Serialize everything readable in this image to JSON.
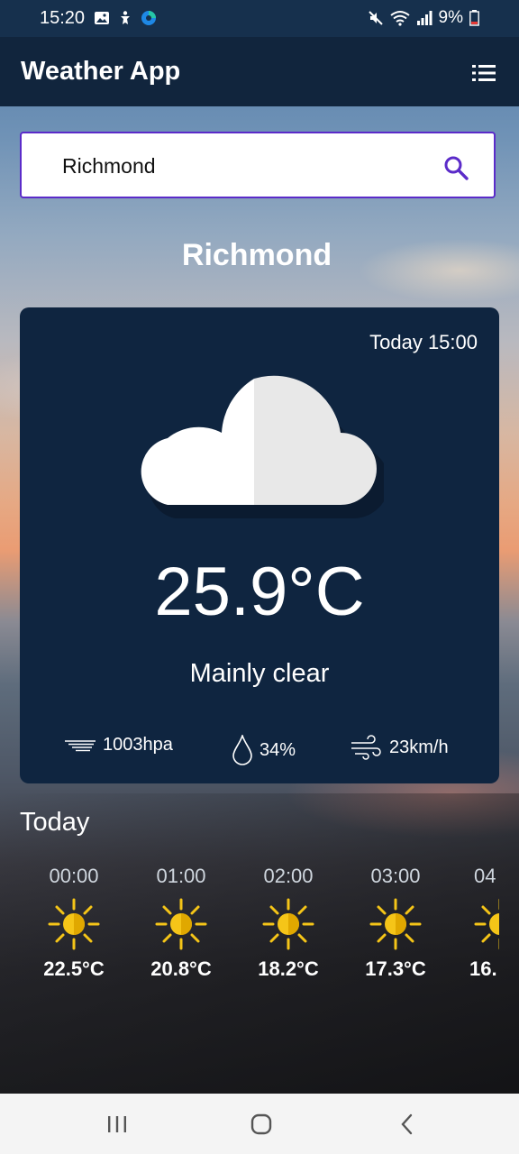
{
  "status_bar": {
    "time": "15:20",
    "battery": "9%"
  },
  "app_bar": {
    "title": "Weather App"
  },
  "search": {
    "value": "Richmond",
    "placeholder": ""
  },
  "city": "Richmond",
  "current": {
    "timestamp": "Today 15:00",
    "temperature": "25.9°C",
    "condition": "Mainly clear",
    "pressure": "1003hpa",
    "humidity": "34%",
    "wind": "23km/h"
  },
  "hourly": {
    "heading": "Today",
    "items": [
      {
        "time": "00:00",
        "temp": "22.5°C"
      },
      {
        "time": "01:00",
        "temp": "20.8°C"
      },
      {
        "time": "02:00",
        "temp": "18.2°C"
      },
      {
        "time": "03:00",
        "temp": "17.3°C"
      },
      {
        "time": "04",
        "temp": "16."
      }
    ]
  },
  "colors": {
    "card": "#0f2540",
    "app_bar": "#11253d",
    "accent": "#5b2bc9",
    "sun": "#f5c518"
  },
  "icons": {
    "menu": "list-menu-icon",
    "search": "search-icon",
    "weather": "cloud-icon",
    "hourly": "sun-icon"
  }
}
